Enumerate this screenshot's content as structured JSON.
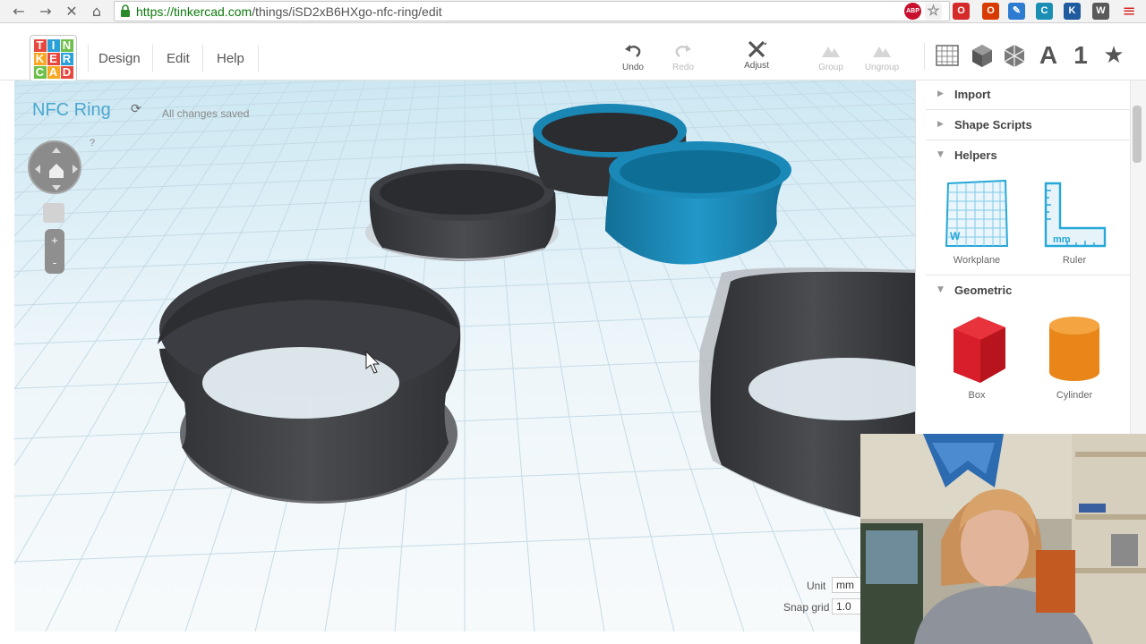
{
  "browser": {
    "url_scheme": "https://",
    "url_host": "tinkercad.com",
    "url_path": "/things/iSD2xB6HXgo-nfc-ring/edit",
    "extensions": [
      {
        "name": "adblock-icon",
        "label": "ABP",
        "color": "#c8102e"
      },
      {
        "name": "star-icon",
        "label": "☆",
        "color": "#f2f2f2"
      },
      {
        "name": "opera-icon",
        "label": "O",
        "color": "#d62a2a"
      },
      {
        "name": "office-icon",
        "label": "O",
        "color": "#d83b01"
      },
      {
        "name": "blue-ext-icon",
        "label": "✎",
        "color": "#2d7cd1"
      },
      {
        "name": "teal-ext-icon",
        "label": "C",
        "color": "#1b8fb3"
      },
      {
        "name": "k-ext-icon",
        "label": "K",
        "color": "#1f5b9e"
      },
      {
        "name": "wordpress-icon",
        "label": "W",
        "color": "#5a5a5a"
      }
    ]
  },
  "header": {
    "logo_letters": [
      "T",
      "I",
      "N",
      "K",
      "E",
      "R",
      "C",
      "A",
      "D"
    ],
    "logo_colors": [
      "#e8473d",
      "#2aa0d8",
      "#6cc04a",
      "#f7a823",
      "#e8473d",
      "#2aa0d8",
      "#6cc04a",
      "#f7a823",
      "#e8473d"
    ],
    "menu": [
      "Design",
      "Edit",
      "Help"
    ],
    "tools": {
      "undo": "Undo",
      "redo": "Redo",
      "adjust": "Adjust",
      "group": "Group",
      "ungroup": "Ungroup"
    }
  },
  "design": {
    "title": "NFC Ring",
    "save_status": "All changes saved",
    "help": "?",
    "zoom_in": "+",
    "zoom_out": "-"
  },
  "settings": {
    "unit_label": "Unit",
    "unit_value": "mm",
    "snap_label": "Snap grid",
    "snap_value": "1.0"
  },
  "panel": {
    "sections": [
      {
        "label": "Import",
        "open": false
      },
      {
        "label": "Shape Scripts",
        "open": false
      },
      {
        "label": "Helpers",
        "open": true
      },
      {
        "label": "Geometric",
        "open": true
      }
    ],
    "helpers": [
      "Workplane",
      "Ruler"
    ],
    "workplane_mark": "W",
    "ruler_mark": "mm",
    "geometric": [
      "Box",
      "Cylinder"
    ]
  },
  "colors": {
    "accent": "#4ca7cf",
    "ring_dark": "#3a3c40",
    "ring_blue": "#1a86b4",
    "box": "#d81e2a",
    "cylinder": "#e8861a"
  }
}
